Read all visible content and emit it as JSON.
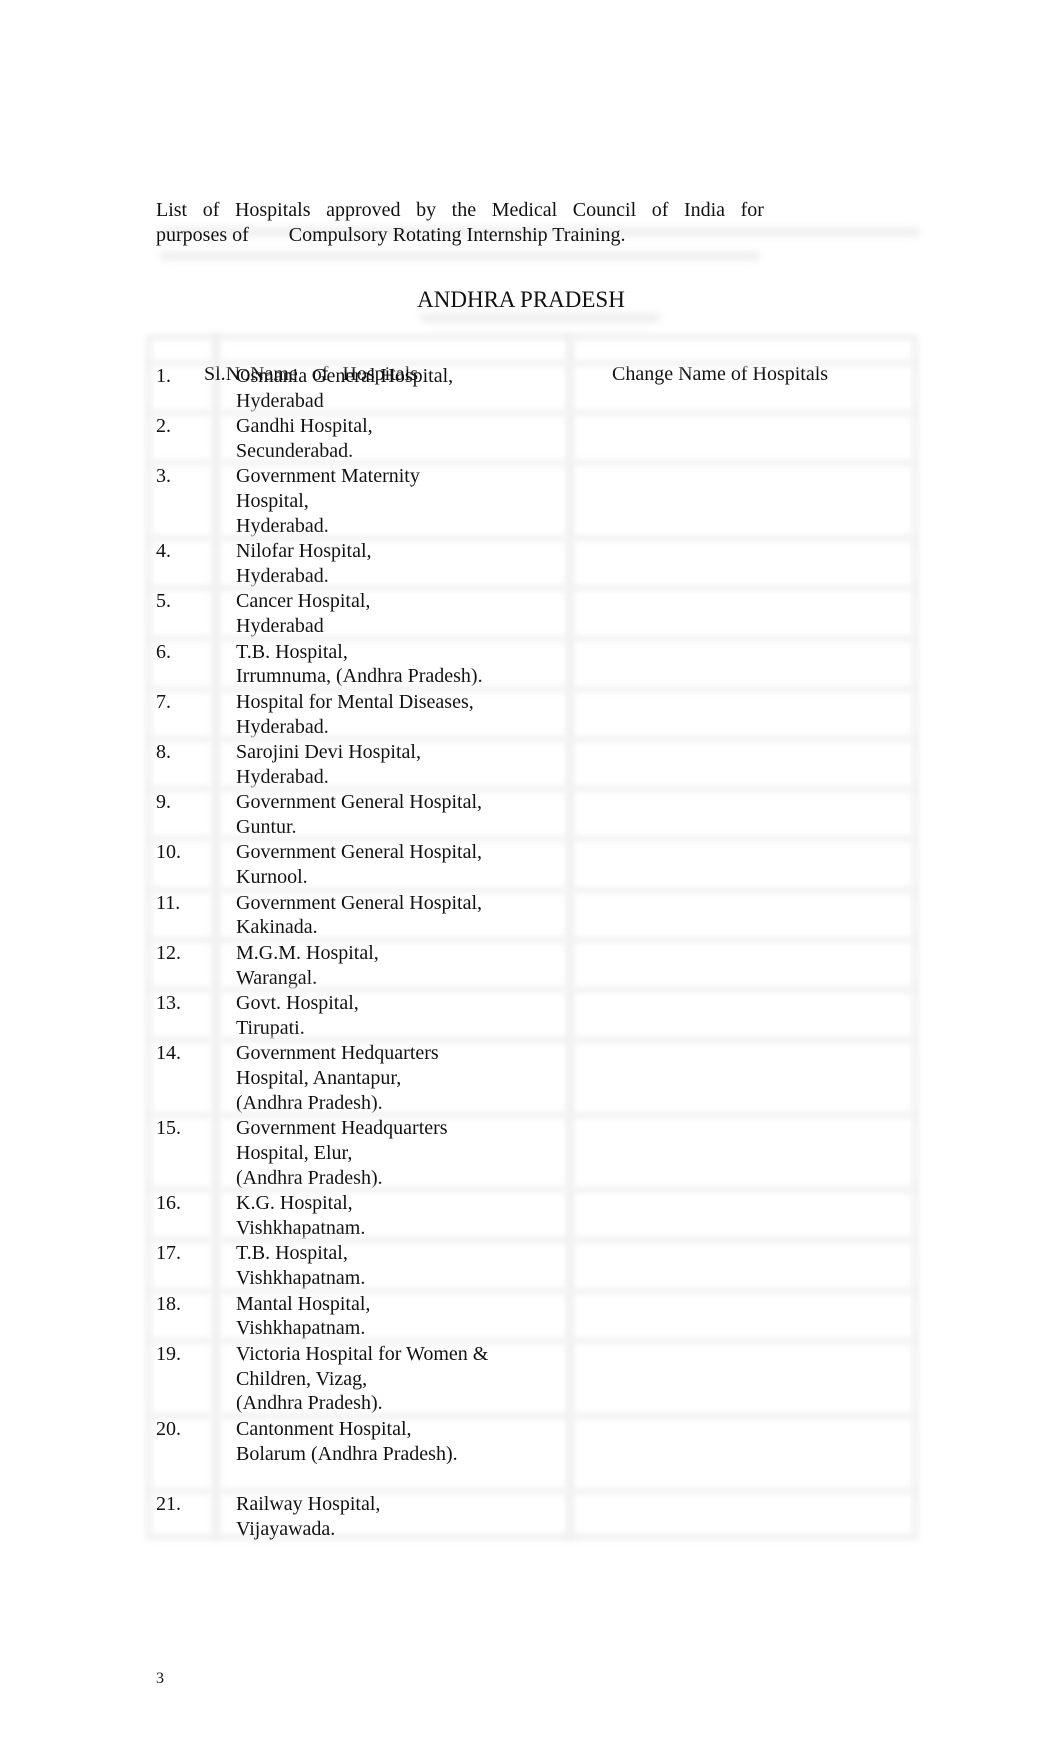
{
  "document": {
    "intro_line1_words": [
      "List",
      "of",
      "Hospitals",
      "approved",
      "by",
      "the",
      "Medical",
      "Council",
      "of",
      "India",
      "for"
    ],
    "intro_line1": "List of Hospitals approved by the Medical Council of India for",
    "intro_line2": "purposes of        Compulsory Rotating Internship Training.",
    "state_heading": "ANDHRA PRADESH",
    "page_number": "3"
  },
  "table": {
    "headers": {
      "sl_no": "Sl.No",
      "name": "Name  of  Hospitals",
      "change_name": "Change Name of Hospitals"
    },
    "rows": [
      {
        "no": "1.",
        "lines": [
          "Osmania General Hospital,",
          "Hyderabad"
        ],
        "change_name": ""
      },
      {
        "no": "2.",
        "lines": [
          "Gandhi Hospital,",
          "Secunderabad."
        ],
        "change_name": ""
      },
      {
        "no": "3.",
        "lines": [
          "Government Maternity",
          "Hospital,",
          "Hyderabad."
        ],
        "change_name": ""
      },
      {
        "no": "4.",
        "lines": [
          "Nilofar Hospital,",
          "Hyderabad."
        ],
        "change_name": ""
      },
      {
        "no": "5.",
        "lines": [
          "Cancer Hospital,",
          "Hyderabad"
        ],
        "change_name": ""
      },
      {
        "no": "6.",
        "lines": [
          "T.B. Hospital,",
          "Irrumnuma, (Andhra Pradesh)."
        ],
        "change_name": ""
      },
      {
        "no": "7.",
        "lines": [
          "Hospital for Mental Diseases,",
          "Hyderabad."
        ],
        "change_name": ""
      },
      {
        "no": "8.",
        "lines": [
          "Sarojini Devi Hospital,",
          "Hyderabad."
        ],
        "change_name": ""
      },
      {
        "no": "9.",
        "lines": [
          "Government General Hospital,",
          "Guntur."
        ],
        "change_name": ""
      },
      {
        "no": "10.",
        "lines": [
          "Government General Hospital,",
          "Kurnool."
        ],
        "change_name": ""
      },
      {
        "no": "11.",
        "lines": [
          "Government General Hospital,",
          "Kakinada."
        ],
        "change_name": ""
      },
      {
        "no": "12.",
        "lines": [
          "M.G.M. Hospital,",
          "Warangal."
        ],
        "change_name": ""
      },
      {
        "no": "13.",
        "lines": [
          "Govt. Hospital,",
          "Tirupati."
        ],
        "change_name": ""
      },
      {
        "no": "14.",
        "lines": [
          "Government Hedquarters",
          "Hospital, Anantapur,",
          "(Andhra Pradesh)."
        ],
        "change_name": ""
      },
      {
        "no": "15.",
        "lines": [
          "Government Headquarters",
          "Hospital, Elur,",
          "(Andhra Pradesh)."
        ],
        "change_name": ""
      },
      {
        "no": "16.",
        "lines": [
          "K.G. Hospital,",
          "Vishkhapatnam."
        ],
        "change_name": ""
      },
      {
        "no": "17.",
        "lines": [
          "T.B. Hospital,",
          "Vishkhapatnam."
        ],
        "change_name": ""
      },
      {
        "no": "18.",
        "lines": [
          "Mantal Hospital,",
          "Vishkhapatnam."
        ],
        "change_name": ""
      },
      {
        "no": "19.",
        "lines": [
          "Victoria Hospital for Women &",
          "Children, Vizag,",
          "(Andhra Pradesh)."
        ],
        "change_name": ""
      },
      {
        "no": "20.",
        "lines": [
          "Cantonment Hospital,",
          "Bolarum (Andhra Pradesh).",
          ""
        ],
        "change_name": ""
      },
      {
        "no": "21.",
        "lines": [
          "Railway Hospital,",
          "Vijayawada."
        ],
        "change_name": ""
      }
    ]
  }
}
